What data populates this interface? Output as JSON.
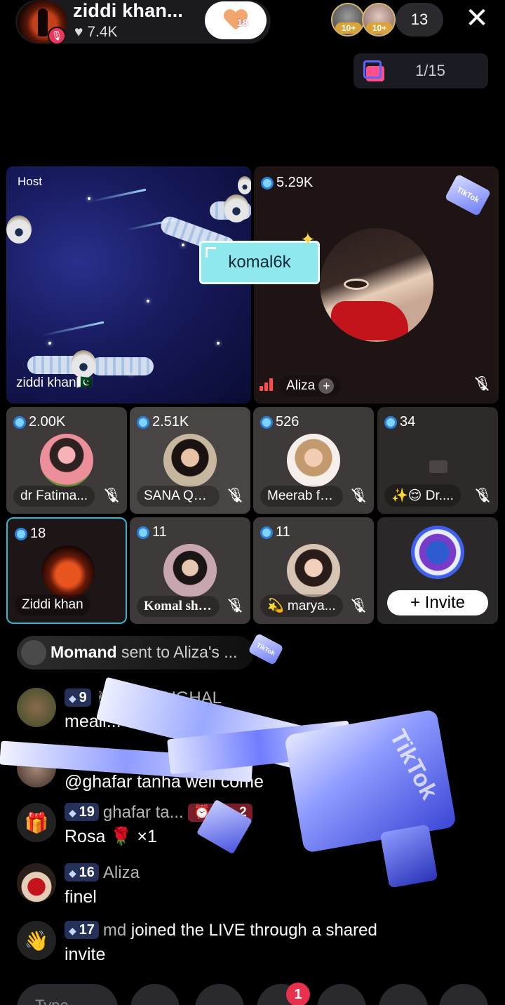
{
  "host": {
    "name": "ziddi khan...",
    "likes": "7.4K",
    "follow_count": "18"
  },
  "top_viewers": [
    {
      "badge": "10+"
    },
    {
      "badge": "10+"
    }
  ],
  "viewer_count": "13",
  "close_icon": "✕",
  "gift_counter": "1/15",
  "stage": {
    "host_tag": "Host",
    "host_name": "ziddi khan🇵🇰",
    "guest_coins": "5.29K",
    "guest_name": "Aliza",
    "name_popup": "komal6k"
  },
  "guests": [
    {
      "coins": "2.00K",
      "name": "dr Fatima...",
      "muted": true
    },
    {
      "coins": "2.51K",
      "name": "SANA Que...",
      "muted": true
    },
    {
      "coins": "526",
      "name": "Meerab fa...",
      "muted": true
    },
    {
      "coins": "34",
      "name": "✨😌 Dr....",
      "muted": true
    },
    {
      "coins": "18",
      "name": "Ziddi khan",
      "muted": false
    },
    {
      "coins": "11",
      "name": "Komal she...",
      "muted": true
    },
    {
      "coins": "11",
      "name": "💫 marya...",
      "muted": true
    }
  ],
  "invite_label": "+ Invite",
  "gift_banner": {
    "sender": "Momand",
    "text": "sent to Aliza's ..."
  },
  "chat": [
    {
      "level": "9",
      "user": "✌MR✌MUGHAL",
      "text": "meaii..."
    },
    {
      "level": "19",
      "user": "",
      "text": "@ghafar tanha well come"
    },
    {
      "level": "19",
      "user": "ghafar ta...",
      "badge": "⏰ No. 2",
      "text": "Rosa 🌹 ×1"
    },
    {
      "level": "16",
      "user": "Aliza",
      "text": "finel"
    },
    {
      "level": "17",
      "user": "md",
      "text_inline": "joined the LIVE through a shared",
      "text": "invite"
    }
  ],
  "bottom": {
    "type_placeholder": "Type...",
    "notification_count": "1"
  },
  "colors": {
    "accent_cyan": "#2fb7d6",
    "popup": "#8fe8ee",
    "level_badge": "#6e8cff",
    "notification": "#e8304f"
  }
}
